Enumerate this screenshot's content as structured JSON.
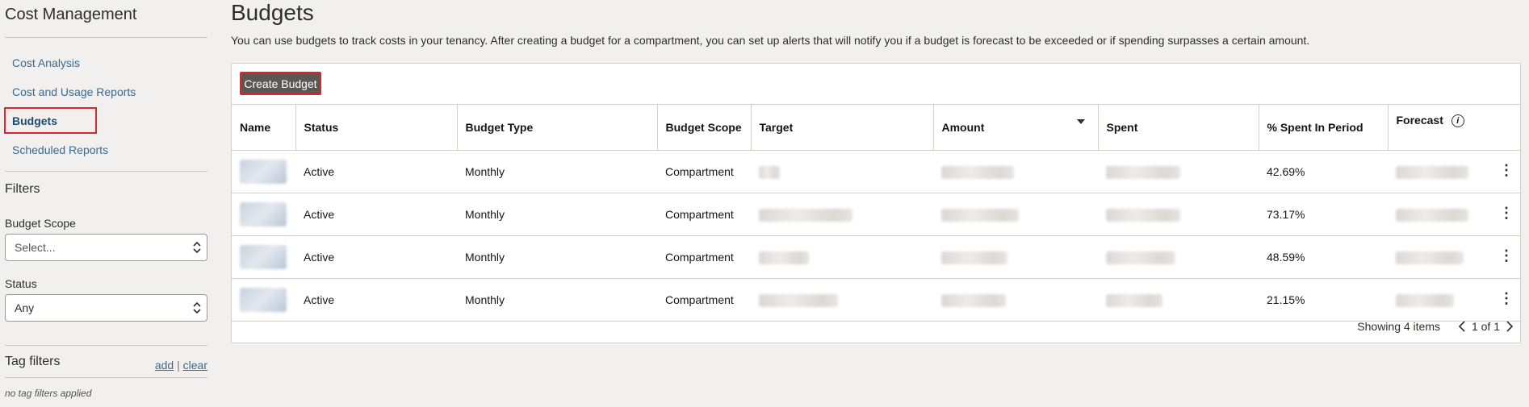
{
  "sidebar": {
    "title": "Cost Management",
    "nav": [
      {
        "label": "Cost Analysis"
      },
      {
        "label": "Cost and Usage Reports"
      },
      {
        "label": "Budgets"
      },
      {
        "label": "Scheduled Reports"
      }
    ],
    "filters_title": "Filters",
    "budget_scope": {
      "label": "Budget Scope",
      "value": "Select..."
    },
    "status": {
      "label": "Status",
      "value": "Any"
    },
    "tag_filters": {
      "title": "Tag filters",
      "add": "add",
      "sep": "|",
      "clear": "clear",
      "empty": "no tag filters applied"
    }
  },
  "main": {
    "title": "Budgets",
    "description": "You can use budgets to track costs in your tenancy. After creating a budget for a compartment, you can set up alerts that will notify you if a budget is forecast to be exceeded or if spending surpasses a certain amount.",
    "create_button": "Create Budget",
    "columns": [
      "Name",
      "Status",
      "Budget Type",
      "Budget Scope",
      "Target",
      "Amount",
      "Spent",
      "% Spent In Period",
      "Forecast"
    ],
    "rows": [
      {
        "status": "Active",
        "type": "Monthly",
        "scope": "Compartment",
        "pct": "42.69%"
      },
      {
        "status": "Active",
        "type": "Monthly",
        "scope": "Compartment",
        "pct": "73.17%"
      },
      {
        "status": "Active",
        "type": "Monthly",
        "scope": "Compartment",
        "pct": "48.59%"
      },
      {
        "status": "Active",
        "type": "Monthly",
        "scope": "Compartment",
        "pct": "21.15%"
      }
    ],
    "showing": "Showing 4 items",
    "page": "1 of 1"
  }
}
